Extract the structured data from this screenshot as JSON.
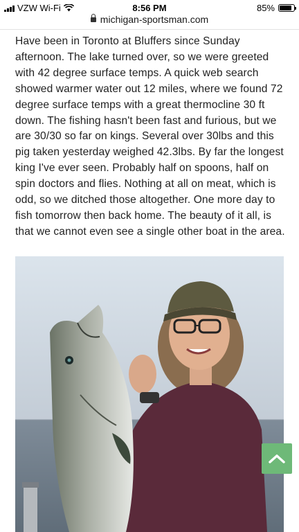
{
  "status_bar": {
    "carrier": "VZW Wi-Fi",
    "time": "8:56 PM",
    "battery": "85%",
    "battery_level": 0.85,
    "icons": [
      "signal-icon",
      "wifi-icon",
      "battery-icon"
    ]
  },
  "browser": {
    "url": "michigan-sportsman.com",
    "icons": [
      "lock-icon"
    ]
  },
  "post": {
    "text": "Have been in Toronto at Bluffers since Sunday afternoon. The lake turned over, so we were greeted with 42 degree surface temps. A quick web search showed warmer water out 12 miles, where we found 72 degree surface temps with a great thermocline 30 ft down. The fishing hasn't been fast and furious, but we are 30/30 so far on kings. Several over 30lbs and this pig taken yesterday weighed 42.3lbs. By far the longest king I've ever seen. Probably half on spoons, half on spin doctors and flies. Nothing at all on meat, which is odd, so we ditched those altogether. One more day to fish tomorrow then back home. The beauty of it all, is that we cannot even see a single other boat in the area.",
    "photo_icon": "fish-photo"
  },
  "scroll_to_top": {
    "icon": "chevron-up-icon",
    "color": "#6eb978"
  }
}
